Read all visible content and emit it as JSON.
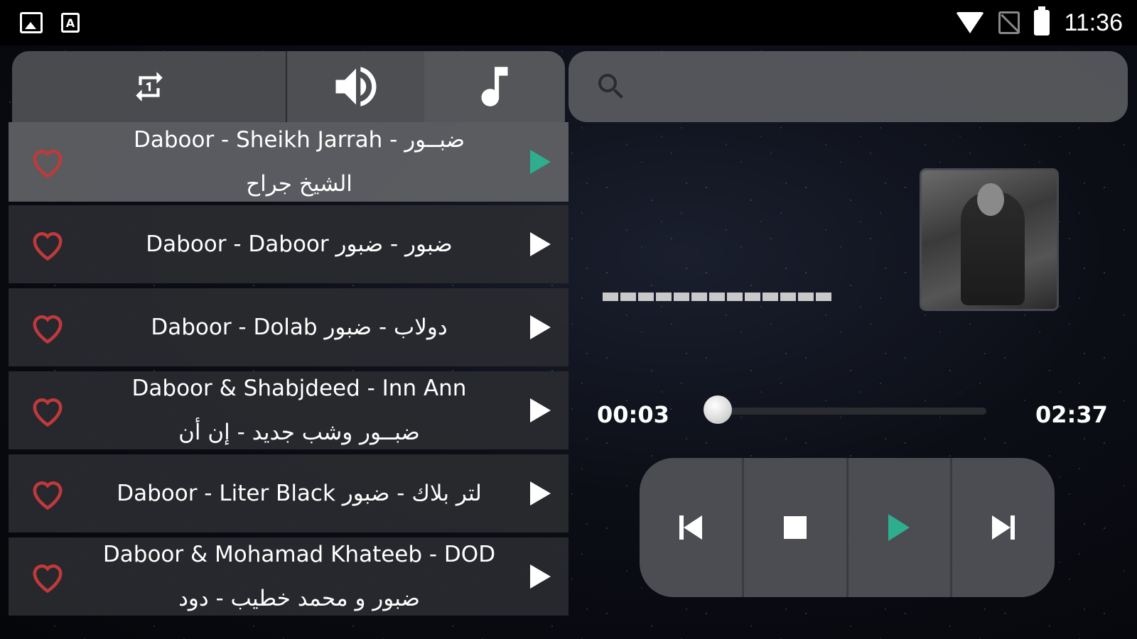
{
  "status_bar": {
    "time": "11:36",
    "left_icons": [
      "gallery-icon",
      "a-icon"
    ],
    "right_icons": [
      "wifi-icon",
      "no-sim-icon",
      "battery-charging-icon"
    ],
    "a_icon_letter": "A"
  },
  "tabs": [
    {
      "icon": "repeat-one-icon"
    },
    {
      "icon": "volume-icon"
    },
    {
      "icon": "music-note-icon"
    }
  ],
  "search": {
    "icon": "search-icon"
  },
  "songs": [
    {
      "title": "Daboor - Sheikh Jarrah - ضبــور\nالشيخ جراح",
      "active": true
    },
    {
      "title": "Daboor - Daboor ضبور - ضبور",
      "active": false
    },
    {
      "title": "Daboor - Dolab دولاب - ضبور",
      "active": false
    },
    {
      "title": "Daboor & Shabjdeed - Inn Ann\nضبــور وشب جديد - إن أن",
      "active": false
    },
    {
      "title": "Daboor - Liter Black لتر بلاك - ضبور",
      "active": false
    },
    {
      "title": "Daboor & Mohamad Khateeb - DOD\nضبور و محمد خطيب - دود",
      "active": false
    }
  ],
  "player": {
    "current_time": "00:03",
    "total_time": "02:37",
    "progress_fraction": 0.02
  },
  "colors": {
    "accent_green": "#2fae8f",
    "heart_red": "#c0393b"
  }
}
